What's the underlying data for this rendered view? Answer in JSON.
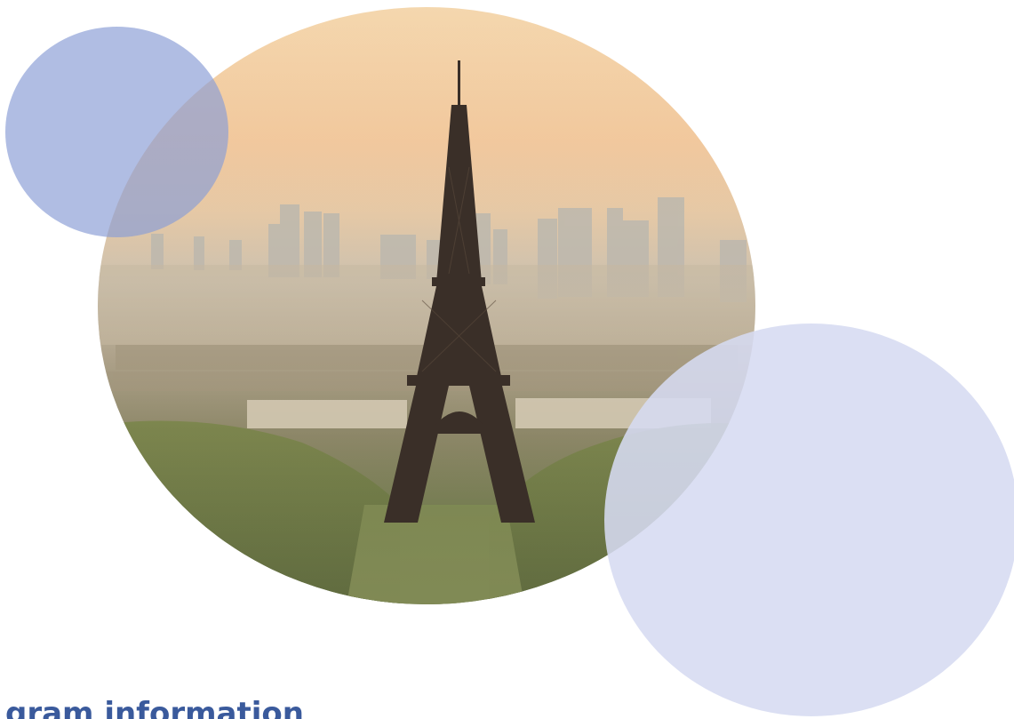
{
  "photo": {
    "subject": "Aerial view of Paris with the Eiffel Tower and La Défense skyline at sunrise",
    "icon": "eiffel-tower-photo"
  },
  "decor": {
    "bubble_top_left_color": "#8a9dd6",
    "bubble_bottom_right_color": "#d6dbf1"
  },
  "section": {
    "heading": "gram information",
    "heading_color": "#3a5a9c"
  }
}
